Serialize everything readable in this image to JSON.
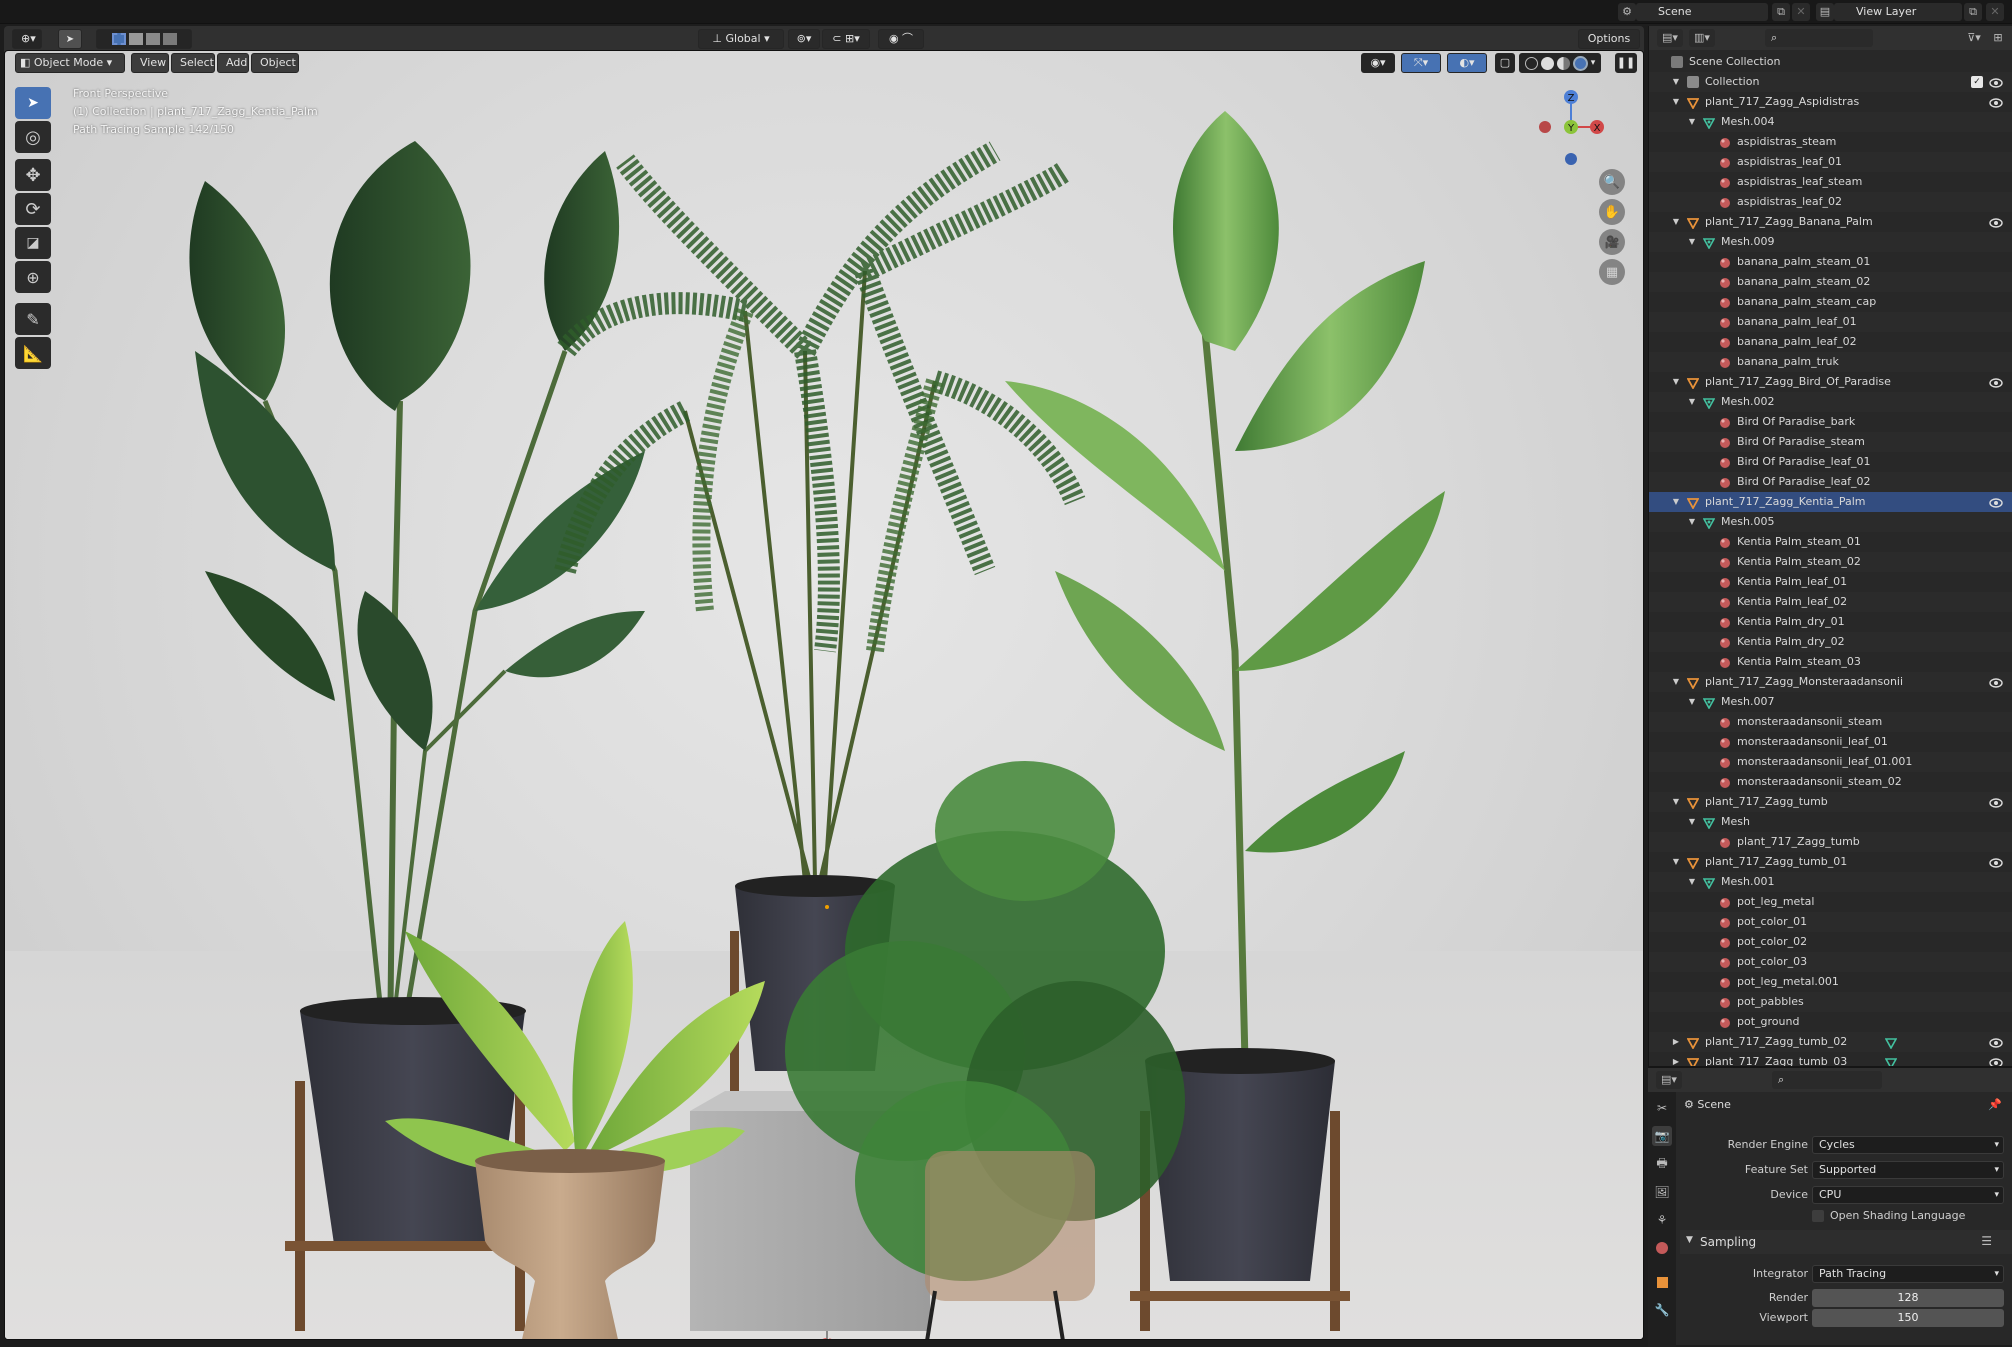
{
  "top_bar": {
    "scene_label": "Scene",
    "view_layer_label": "View Layer"
  },
  "viewport_header": {
    "mode": "Object Mode",
    "menus": [
      "View",
      "Select",
      "Add",
      "Object"
    ],
    "orientation": "Global",
    "options_label": "Options"
  },
  "viewport_overlay": {
    "view_name": "Front Perspective",
    "collection_info": "(1) Collection | plant_717_Zagg_Kentia_Palm",
    "sample_info": "Path Tracing Sample 142/150"
  },
  "gizmo": {
    "z": "Z",
    "y": "Y",
    "x": "X"
  },
  "outliner": {
    "root": "Scene Collection",
    "collection": "Collection",
    "rows": [
      {
        "label": "plant_717_Zagg_Aspidistras",
        "type": "object",
        "level": 1,
        "eye": true
      },
      {
        "label": "Mesh.004",
        "type": "mesh",
        "level": 2
      },
      {
        "label": "aspidistras_steam",
        "type": "material",
        "level": 3
      },
      {
        "label": "aspidistras_leaf_01",
        "type": "material",
        "level": 3
      },
      {
        "label": "aspidistras_leaf_steam",
        "type": "material",
        "level": 3
      },
      {
        "label": "aspidistras_leaf_02",
        "type": "material",
        "level": 3
      },
      {
        "label": "plant_717_Zagg_Banana_Palm",
        "type": "object",
        "level": 1,
        "eye": true
      },
      {
        "label": "Mesh.009",
        "type": "mesh",
        "level": 2
      },
      {
        "label": "banana_palm_steam_01",
        "type": "material",
        "level": 3
      },
      {
        "label": "banana_palm_steam_02",
        "type": "material",
        "level": 3
      },
      {
        "label": "banana_palm_steam_cap",
        "type": "material",
        "level": 3
      },
      {
        "label": "banana_palm_leaf_01",
        "type": "material",
        "level": 3
      },
      {
        "label": "banana_palm_leaf_02",
        "type": "material",
        "level": 3
      },
      {
        "label": "banana_palm_truk",
        "type": "material",
        "level": 3
      },
      {
        "label": "plant_717_Zagg_Bird_Of_Paradise",
        "type": "object",
        "level": 1,
        "eye": true
      },
      {
        "label": "Mesh.002",
        "type": "mesh",
        "level": 2
      },
      {
        "label": "Bird Of Paradise_bark",
        "type": "material",
        "level": 3
      },
      {
        "label": "Bird Of Paradise_steam",
        "type": "material",
        "level": 3
      },
      {
        "label": "Bird Of Paradise_leaf_01",
        "type": "material",
        "level": 3
      },
      {
        "label": "Bird Of Paradise_leaf_02",
        "type": "material",
        "level": 3
      },
      {
        "label": "plant_717_Zagg_Kentia_Palm",
        "type": "object",
        "level": 1,
        "eye": true,
        "active": true
      },
      {
        "label": "Mesh.005",
        "type": "mesh",
        "level": 2
      },
      {
        "label": "Kentia Palm_steam_01",
        "type": "material",
        "level": 3
      },
      {
        "label": "Kentia Palm_steam_02",
        "type": "material",
        "level": 3
      },
      {
        "label": "Kentia Palm_leaf_01",
        "type": "material",
        "level": 3
      },
      {
        "label": "Kentia Palm_leaf_02",
        "type": "material",
        "level": 3
      },
      {
        "label": "Kentia Palm_dry_01",
        "type": "material",
        "level": 3
      },
      {
        "label": "Kentia Palm_dry_02",
        "type": "material",
        "level": 3
      },
      {
        "label": "Kentia Palm_steam_03",
        "type": "material",
        "level": 3
      },
      {
        "label": "plant_717_Zagg_Monsteraadansonii",
        "type": "object",
        "level": 1,
        "eye": true
      },
      {
        "label": "Mesh.007",
        "type": "mesh",
        "level": 2
      },
      {
        "label": "monsteraadansonii_steam",
        "type": "material",
        "level": 3
      },
      {
        "label": "monsteraadansonii_leaf_01",
        "type": "material",
        "level": 3
      },
      {
        "label": "monsteraadansonii_leaf_01.001",
        "type": "material",
        "level": 3
      },
      {
        "label": "monsteraadansonii_steam_02",
        "type": "material",
        "level": 3
      },
      {
        "label": "plant_717_Zagg_tumb",
        "type": "object",
        "level": 1,
        "eye": true
      },
      {
        "label": "Mesh",
        "type": "mesh",
        "level": 2
      },
      {
        "label": "plant_717_Zagg_tumb",
        "type": "material",
        "level": 3
      },
      {
        "label": "plant_717_Zagg_tumb_01",
        "type": "object",
        "level": 1,
        "eye": true
      },
      {
        "label": "Mesh.001",
        "type": "mesh",
        "level": 2
      },
      {
        "label": "pot_leg_metal",
        "type": "material",
        "level": 3
      },
      {
        "label": "pot_color_01",
        "type": "material",
        "level": 3
      },
      {
        "label": "pot_color_02",
        "type": "material",
        "level": 3
      },
      {
        "label": "pot_color_03",
        "type": "material",
        "level": 3
      },
      {
        "label": "pot_leg_metal.001",
        "type": "material",
        "level": 3
      },
      {
        "label": "pot_pabbles",
        "type": "material",
        "level": 3
      },
      {
        "label": "pot_ground",
        "type": "material",
        "level": 3
      },
      {
        "label": "plant_717_Zagg_tumb_02",
        "type": "object",
        "level": 1,
        "eye": true,
        "collapsed": true
      },
      {
        "label": "plant_717_Zagg_tumb_03",
        "type": "object",
        "level": 1,
        "eye": true,
        "collapsed": true
      }
    ]
  },
  "properties": {
    "context": "Scene",
    "render_engine_label": "Render Engine",
    "render_engine": "Cycles",
    "feature_set_label": "Feature Set",
    "feature_set": "Supported",
    "device_label": "Device",
    "device": "CPU",
    "osl_label": "Open Shading Language",
    "sampling_label": "Sampling",
    "integrator_label": "Integrator",
    "integrator": "Path Tracing",
    "render_label": "Render",
    "render_samples": "128",
    "viewport_label": "Viewport",
    "viewport_samples": "150"
  },
  "colors": {
    "accent": "#4772b3",
    "object_icon": "#e8923a",
    "mesh_icon": "#43c1a0",
    "material_icon": "#c45a5a"
  }
}
